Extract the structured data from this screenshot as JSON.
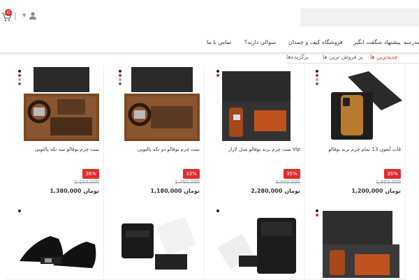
{
  "header": {
    "cart_count": "0",
    "separator": "|",
    "nav": [
      {
        "label": "تماس با ما"
      },
      {
        "label": "سوالی دارید؟"
      },
      {
        "label": "فروشگاه کیف و چمدان"
      },
      {
        "label": "پیشنهاد شگفت انگیز"
      },
      {
        "label": "مدرسه"
      }
    ]
  },
  "tabs": [
    {
      "label": "جدیدترین ها"
    },
    {
      "label": "پر فروش ترین ها"
    },
    {
      "label": "برگزیده‌ها"
    }
  ],
  "products": [
    {
      "title": "قاب آیفون 13 تمام چرم برند بوفالو",
      "discount": "35%",
      "old_price": "1,850,000",
      "price": "1,200,000 تومان"
    },
    {
      "title": "ست چرم برند بوفالو مدل لازار Vip",
      "discount": "35%",
      "old_price": "3,500,000",
      "price": "2,280,000 تومان"
    },
    {
      "title": "ست چرم بوفالو دو تکه پالتویی",
      "discount": "33%",
      "old_price": "1,750,000",
      "price": "1,180,000 تومان"
    },
    {
      "title": "ست چرم بوفالو سه تکه پالتویی",
      "discount": "36%",
      "old_price": "2,150,000",
      "price": "1,380,000 تومان"
    }
  ],
  "colors": {
    "accent": "#e12b2b"
  }
}
